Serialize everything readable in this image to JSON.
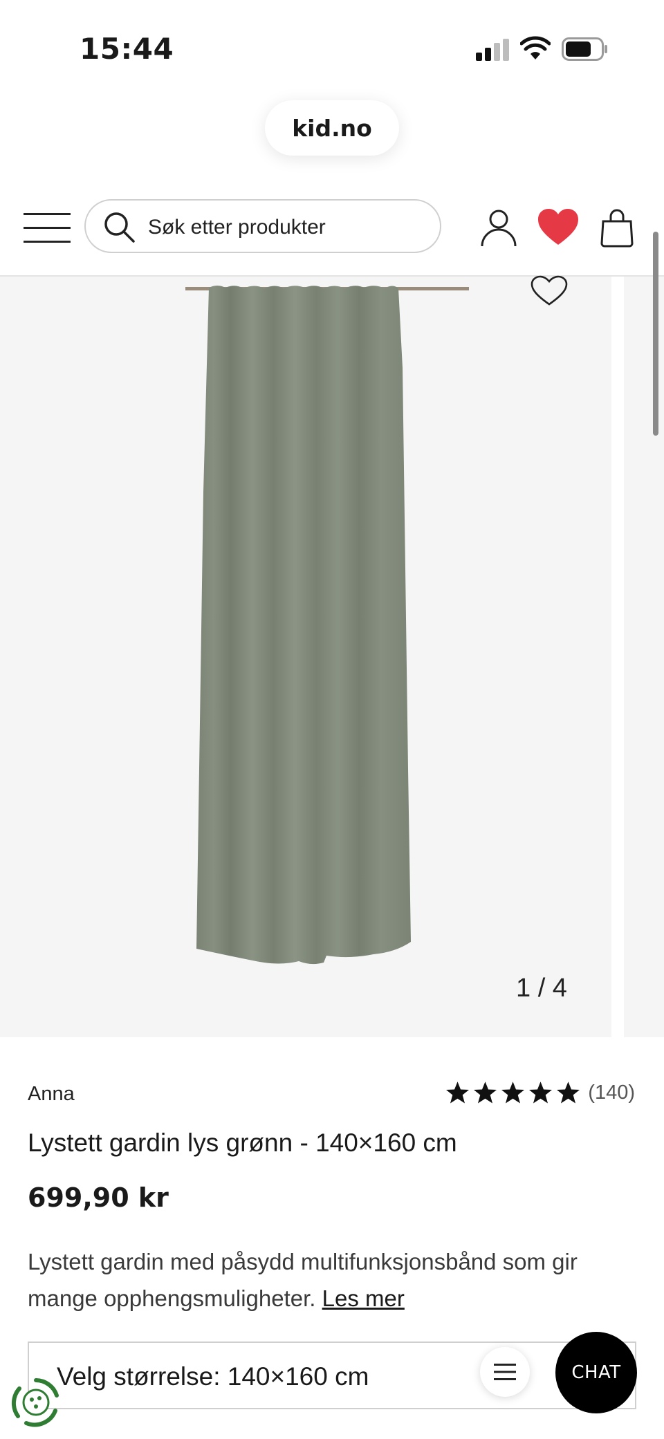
{
  "status_bar": {
    "time": "15:44"
  },
  "browser": {
    "url": "kid.no"
  },
  "header": {
    "search_placeholder": "Søk etter produkter"
  },
  "gallery": {
    "counter": "1 / 4"
  },
  "product": {
    "brand": "Anna",
    "rating_stars": 5,
    "review_count": "(140)",
    "title": "Lystett gardin lys grønn - 140×160 cm",
    "price": "699,90 kr",
    "description": "Lystett gardin med påsydd multifunksjonsbånd som gir mange opphengsmuligheter.",
    "read_more": "Les mer",
    "size_label": "Velg størrelse: 140×160 cm"
  },
  "chat": {
    "label": "CHAT"
  },
  "colors": {
    "accent_heart": "#e63946",
    "curtain": "#7d8677",
    "text": "#1a1a1a"
  }
}
